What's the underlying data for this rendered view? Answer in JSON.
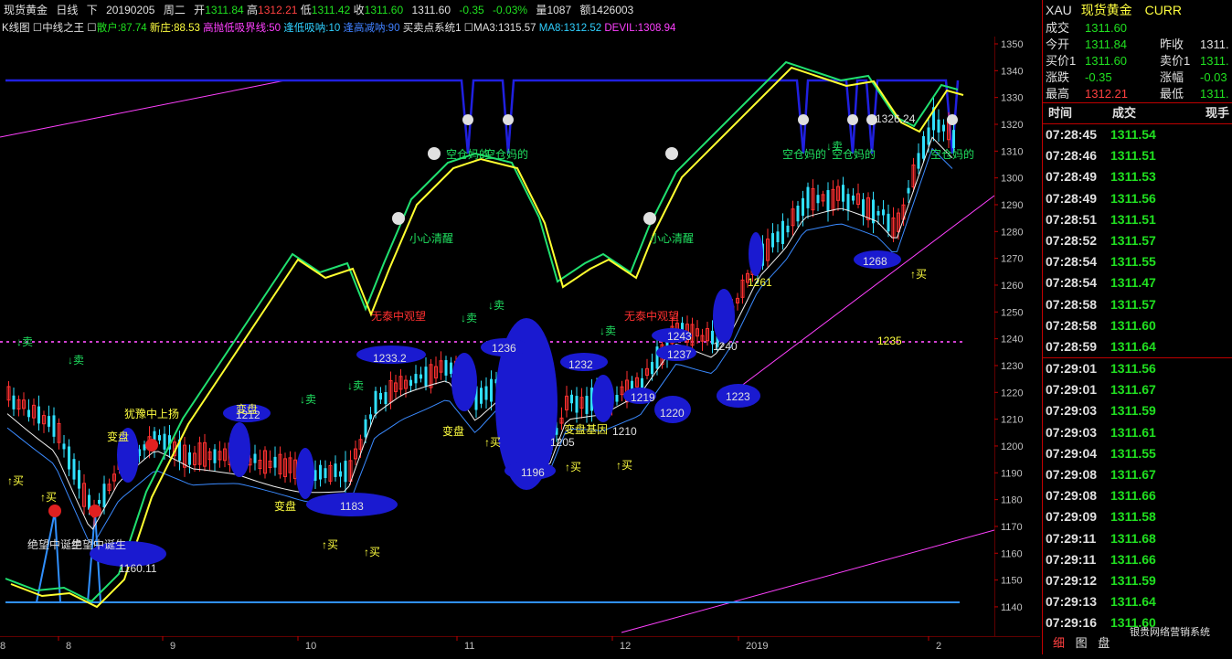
{
  "header": {
    "name": "现货黄金",
    "period": "日线",
    "direction": "下",
    "date": "20190205",
    "weekday": "周二",
    "open_label": "开",
    "open": "1311.84",
    "high_label": "高",
    "high": "1312.21",
    "low_label": "低",
    "low": "1311.42",
    "close_label": "收",
    "close": "1311.60",
    "last": "1311.60",
    "change": "-0.35",
    "change_pct": "-0.03%",
    "volume_label": "量",
    "volume": "1087",
    "amount_label": "额",
    "amount": "1426003"
  },
  "indicators": {
    "kline": "K线图",
    "system": "中线之王",
    "sanhu": "散户:87.74",
    "xinzhuang": "新庄:88.53",
    "gaopao": "高抛低吸界线:50",
    "fengdi": "逢低吸呐:10",
    "fenggao": "逢高减呐:90",
    "maimai": "买卖点系统1",
    "ma3": "MA3:1315.57",
    "ma8": "MA8:1312.52",
    "devil": "DEVIL:1308.94"
  },
  "colors": {
    "up": "#ff3030",
    "down": "#30e0ff",
    "yellow": "#ffff30",
    "green": "#20e060",
    "blue": "#2020e0",
    "magenta": "#ff40ff",
    "accent": "#c00000"
  },
  "y_ticks": [
    "1350",
    "1340",
    "1330",
    "1320",
    "1310",
    "1300",
    "1290",
    "1280",
    "1270",
    "1260",
    "1250",
    "1240",
    "1230",
    "1220",
    "1210",
    "1200",
    "1190",
    "1180",
    "1170",
    "1160",
    "1150",
    "1140"
  ],
  "x_ticks": [
    "8",
    "9",
    "10",
    "11",
    "12",
    "2019",
    "2"
  ],
  "x_first": "8",
  "chart_labels": {
    "buy": "↑买",
    "sell": "↓卖",
    "biandan": "变盘",
    "bianpan_base": "变盘基因",
    "youyu": "犹豫中上扬",
    "xiaoxin": "小心清醒",
    "kongdan": "空仓妈的",
    "wutai": "无泰中观望",
    "juewang": "绝望中诞生",
    "n1160": "1160.11",
    "n1183": "1183",
    "n1233": "1233.2",
    "n1236": "1236",
    "n1232": "1232",
    "n1196": "1196",
    "n1205": "1205",
    "n1210": "1210",
    "n1219": "1219",
    "n1220": "1220",
    "n1223": "1223",
    "n1237": "1237",
    "n1243": "1243",
    "n1240": "1240",
    "n1261": "1261",
    "n1268": "1268",
    "n1235": "1235",
    "n1326": "1326.24",
    "n1212": "1212"
  },
  "panel": {
    "title_code": "XAU",
    "title_name": "现货黄金",
    "title_market": "CURR",
    "rows": [
      {
        "l1": "成交",
        "v1": "1311.60",
        "c1": "#20e020",
        "l2": "",
        "v2": "",
        "c2": ""
      },
      {
        "l1": "今开",
        "v1": "1311.84",
        "c1": "#20e020",
        "l2": "昨收",
        "v2": "1311.",
        "c2": "#e0e0e0"
      },
      {
        "l1": "买价1",
        "v1": "1311.60",
        "c1": "#20e020",
        "l2": "卖价1",
        "v2": "1311.",
        "c2": "#20e020"
      },
      {
        "l1": "涨跌",
        "v1": "-0.35",
        "c1": "#20e020",
        "l2": "涨幅",
        "v2": "-0.03",
        "c2": "#20e020"
      },
      {
        "l1": "最高",
        "v1": "1312.21",
        "c1": "#ff4040",
        "l2": "最低",
        "v2": "1311.",
        "c2": "#20e020"
      }
    ],
    "col_time": "时间",
    "col_price": "成交",
    "col_vol": "现手",
    "ticks": [
      {
        "t": "07:28:45",
        "p": "1311.54"
      },
      {
        "t": "07:28:46",
        "p": "1311.51"
      },
      {
        "t": "07:28:49",
        "p": "1311.53"
      },
      {
        "t": "07:28:49",
        "p": "1311.56"
      },
      {
        "t": "07:28:51",
        "p": "1311.51"
      },
      {
        "t": "07:28:52",
        "p": "1311.57"
      },
      {
        "t": "07:28:54",
        "p": "1311.55"
      },
      {
        "t": "07:28:54",
        "p": "1311.47"
      },
      {
        "t": "07:28:58",
        "p": "1311.57"
      },
      {
        "t": "07:28:58",
        "p": "1311.60"
      },
      {
        "t": "07:28:59",
        "p": "1311.64"
      },
      {
        "t": "07:29:01",
        "p": "1311.56"
      },
      {
        "t": "07:29:01",
        "p": "1311.67"
      },
      {
        "t": "07:29:03",
        "p": "1311.59"
      },
      {
        "t": "07:29:03",
        "p": "1311.61"
      },
      {
        "t": "07:29:04",
        "p": "1311.55"
      },
      {
        "t": "07:29:08",
        "p": "1311.67"
      },
      {
        "t": "07:29:08",
        "p": "1311.66"
      },
      {
        "t": "07:29:09",
        "p": "1311.58"
      },
      {
        "t": "07:29:11",
        "p": "1311.68"
      },
      {
        "t": "07:29:11",
        "p": "1311.66"
      },
      {
        "t": "07:29:12",
        "p": "1311.59"
      },
      {
        "t": "07:29:13",
        "p": "1311.64"
      },
      {
        "t": "07:29:16",
        "p": "1311.60"
      }
    ],
    "tabs": [
      "细",
      "图",
      "盘"
    ]
  },
  "watermark": "银贵网络营销系统"
}
